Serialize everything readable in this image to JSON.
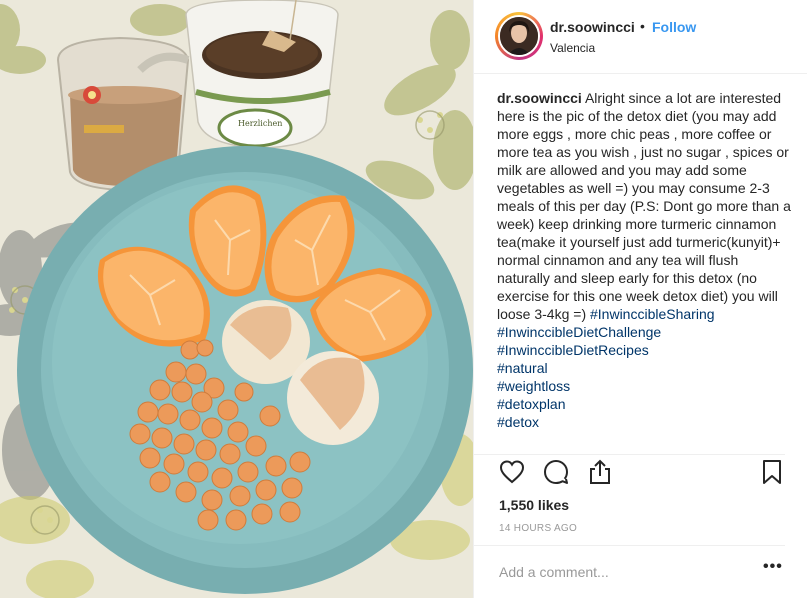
{
  "post": {
    "username": "dr.soowincci",
    "separator": "•",
    "follow_label": "Follow",
    "location": "Valencia"
  },
  "caption": {
    "username": "dr.soowincci",
    "text": "Alright since a lot are interested here is the pic of the detox diet (you may add more eggs , more chic peas , more coffee or more tea as you wish , just no sugar , spices or milk are allowed and you may add some vegetables as well =) you may consume 2-3 meals of this per day (P.S: Dont go more than a week) keep drinking more turmeric cinnamon tea(make it yourself just add turmeric(kunyit)+ normal cinnamon and any tea will flush naturally and sleep early for this detox (no exercise for this one week detox diet) you will loose 3-4kg =) ",
    "hashtags": [
      "#InwinccibleSharing",
      "#InwinccibleDietChallenge",
      "#InwinccibleDietRecipes",
      "#natural",
      "#weightloss",
      "#detoxplan",
      "#detox"
    ]
  },
  "stats": {
    "likes": "1,550 likes",
    "time": "14 HOURS AGO"
  },
  "comment": {
    "placeholder": "Add a comment...",
    "more_label": "•••"
  },
  "icons": [
    "heart-icon",
    "comment-icon",
    "share-icon",
    "bookmark-icon"
  ],
  "colors": {
    "link": "#3897f0",
    "hashtag": "#003569",
    "muted": "#999999",
    "text": "#262626"
  }
}
